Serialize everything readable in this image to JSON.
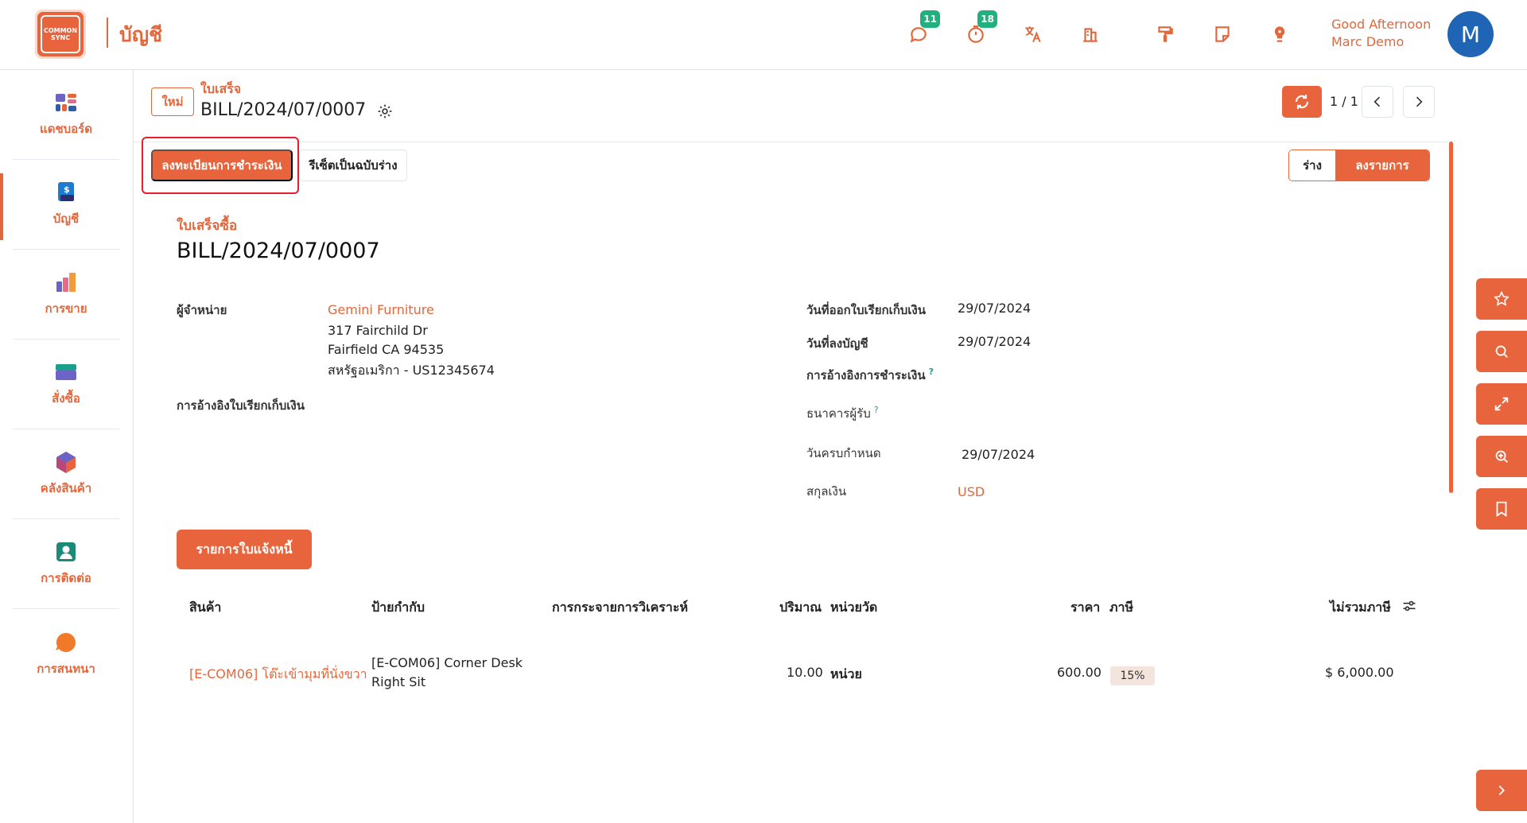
{
  "header": {
    "logo_text": "COMMON SYNC",
    "app_title": "บัญชี",
    "messages_badge": "11",
    "activities_badge": "18",
    "greeting_line1": "Good Afternoon",
    "greeting_line2": "Marc Demo",
    "avatar_initial": "M"
  },
  "sidebar": {
    "items": [
      {
        "label": "แดชบอร์ด",
        "icon": "dashboard-icon"
      },
      {
        "label": "บัญชี",
        "icon": "accounting-icon"
      },
      {
        "label": "การขาย",
        "icon": "sales-icon"
      },
      {
        "label": "สั่งซื้อ",
        "icon": "purchase-icon"
      },
      {
        "label": "คลังสินค้า",
        "icon": "inventory-icon"
      },
      {
        "label": "การติดต่อ",
        "icon": "contacts-icon"
      },
      {
        "label": "การสนทนา",
        "icon": "discuss-icon"
      }
    ],
    "active_index": 1
  },
  "breadcrumb": {
    "new_button": "ใหม่",
    "parent": "ใบเสร็จ",
    "current": "BILL/2024/07/0007"
  },
  "pager": {
    "value": "1 / 1"
  },
  "actions": {
    "post_payment": "ลงทะเบียนการชำระเงิน",
    "reset_draft": "รีเซ็ตเป็นฉบับร่าง"
  },
  "status": {
    "draft": "ร่าง",
    "posted": "ลงรายการ",
    "active": "posted"
  },
  "form": {
    "doc_type": "ใบเสร็จซื้อ",
    "doc_number": "BILL/2024/07/0007",
    "vendor_label": "ผู้จำหน่าย",
    "vendor_name": "Gemini Furniture",
    "vendor_address_1": "317 Fairchild Dr",
    "vendor_address_2": "Fairfield CA 94535",
    "vendor_address_3": "สหรัฐอเมริกา - US12345674",
    "bill_reference_label": "การอ้างอิงใบเรียกเก็บเงิน",
    "bill_date_label": "วันที่ออกใบเรียกเก็บเงิน",
    "bill_date": "29/07/2024",
    "accounting_date_label": "วันที่ลงบัญชี",
    "accounting_date": "29/07/2024",
    "payment_reference_label": "การอ้างอิงการชำระเงิน",
    "recipient_bank_label": "ธนาคารผู้รับ",
    "due_date_label": "วันครบกำหนด",
    "due_date": "29/07/2024",
    "currency_label": "สกุลเงิน",
    "currency": "USD",
    "help_mark": "?"
  },
  "lines_tab": {
    "label": "รายการใบแจ้งหนี้"
  },
  "table": {
    "headers": {
      "product": "สินค้า",
      "label": "ป้ายกำกับ",
      "analytic": "การกระจายการวิเคราะห์",
      "quantity": "ปริมาณ",
      "uom": "หน่วยวัด",
      "price": "ราคา",
      "taxes": "ภาษี",
      "subtotal": "ไม่รวมภาษี"
    },
    "rows": [
      {
        "product": "[E-COM06] โต๊ะเข้ามุมที่นั่งขวา",
        "label_line1": "[E-COM06] Corner Desk",
        "label_line2": "Right Sit",
        "quantity": "10.00",
        "uom": "หน่วย",
        "price": "600.00",
        "tax": "15%",
        "subtotal": "$ 6,000.00"
      }
    ]
  },
  "floating_actions": [
    "star-icon",
    "search-icon",
    "expand-icon",
    "zoom-in-icon",
    "bookmark-icon",
    "chevron-right-icon"
  ],
  "colors": {
    "accent": "#e8643c",
    "text_accent": "#e2673d",
    "badge": "#22b07d",
    "highlight": "#e51f2b",
    "avatar": "#1f64b5"
  }
}
